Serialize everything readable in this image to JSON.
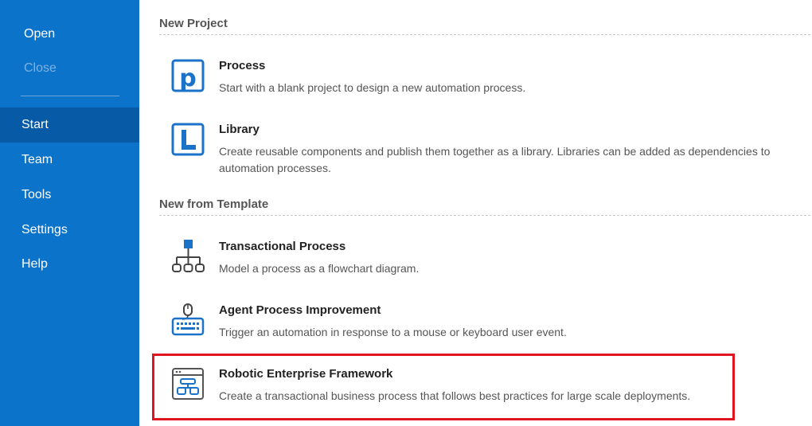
{
  "sidebar": {
    "open": "Open",
    "close": "Close",
    "items": [
      {
        "label": "Start",
        "active": true
      },
      {
        "label": "Team"
      },
      {
        "label": "Tools"
      },
      {
        "label": "Settings"
      },
      {
        "label": "Help"
      }
    ]
  },
  "sections": {
    "new_project": "New Project",
    "new_from_template": "New from Template"
  },
  "projects": {
    "process": {
      "title": "Process",
      "desc": "Start with a blank project to design a new automation process.",
      "icon": "process-icon"
    },
    "library": {
      "title": "Library",
      "desc": "Create reusable components and publish them together as a library. Libraries can be added as dependencies to automation processes.",
      "icon": "library-icon"
    }
  },
  "templates": {
    "transactional": {
      "title": "Transactional Process",
      "desc": "Model a process as a flowchart diagram.",
      "icon": "flowchart-icon"
    },
    "agent": {
      "title": "Agent Process Improvement",
      "desc": "Trigger an automation in response to a mouse or keyboard user event.",
      "icon": "keyboard-mouse-icon"
    },
    "ref": {
      "title": "Robotic Enterprise Framework",
      "desc": "Create a transactional business process that follows best practices for large scale deployments.",
      "icon": "framework-icon"
    }
  },
  "colors": {
    "sidebar": "#0b73c9",
    "sidebar_active": "#075ba6",
    "icon_blue": "#1a73c9",
    "highlight": "#e0151f"
  }
}
